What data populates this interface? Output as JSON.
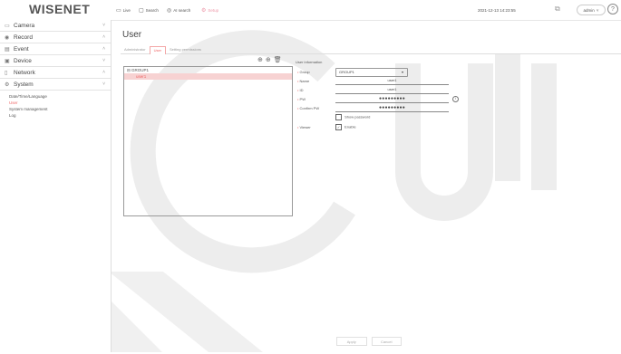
{
  "topbar": {
    "logo": "WISENET",
    "buttons": [
      {
        "label": "Live",
        "icon": "live-icon"
      },
      {
        "label": "Search",
        "icon": "search-icon"
      },
      {
        "label": "AI search",
        "icon": "ai-search-icon"
      },
      {
        "label": "Setup",
        "icon": "setup-icon"
      }
    ],
    "datetime": "2021-12-13 14:23:55",
    "user": "admin"
  },
  "sidebar": {
    "items": [
      {
        "label": "Camera",
        "icon": "camera-icon",
        "chevron": "˅"
      },
      {
        "label": "Record",
        "icon": "record-icon",
        "chevron": "˄"
      },
      {
        "label": "Event",
        "icon": "event-icon",
        "chevron": "˄"
      },
      {
        "label": "Device",
        "icon": "device-icon",
        "chevron": "˅"
      },
      {
        "label": "Network",
        "icon": "network-icon",
        "chevron": "˄"
      },
      {
        "label": "System",
        "icon": "system-icon",
        "chevron": "˅"
      }
    ],
    "submenu": [
      {
        "label": "Date/Time/Language",
        "active": false
      },
      {
        "label": "User",
        "active": true
      },
      {
        "label": "System management",
        "active": false
      },
      {
        "label": "Log",
        "active": false
      }
    ]
  },
  "main": {
    "title": "User",
    "tabs": [
      {
        "label": "Administrator",
        "active": false
      },
      {
        "label": "User",
        "active": true
      },
      {
        "label": "Setting permissions",
        "active": false
      }
    ],
    "tree": [
      {
        "label": "GROUP1",
        "selected": false
      },
      {
        "label": "user1",
        "selected": true
      }
    ],
    "info": {
      "title": "User information",
      "group_label": "Group",
      "group_value": "GROUP1",
      "name_label": "Name",
      "name_value": "user1",
      "id_label": "ID",
      "id_value": "user1",
      "pw_label": "PW",
      "pw_value": "●●●●●●●●●",
      "confirm_label": "Confirm PW",
      "confirm_value": "●●●●●●●●●",
      "show_password": "Show password",
      "viewer_label": "Viewer",
      "viewer_value": "Enable"
    },
    "buttons": [
      "Apply",
      "Cancel"
    ]
  },
  "colors": {
    "accent": "#e66666",
    "selected_bg": "#f7d2d2"
  }
}
